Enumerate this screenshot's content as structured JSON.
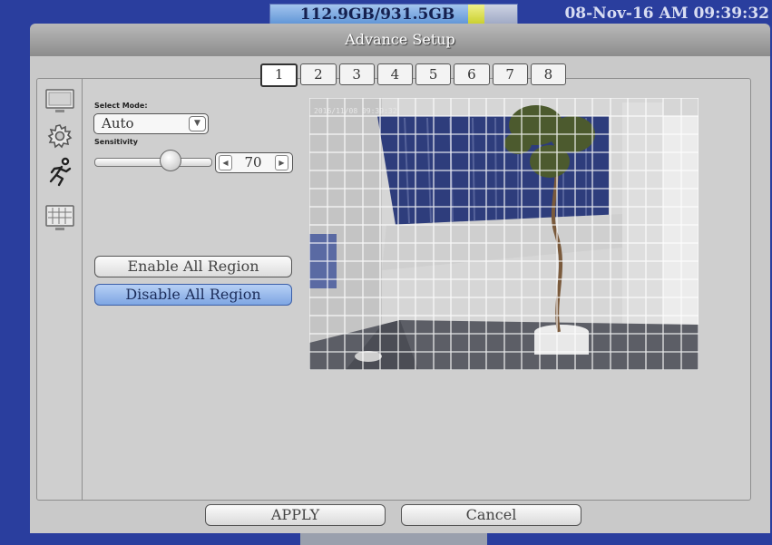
{
  "status": {
    "disk_usage": "112.9GB/931.5GB",
    "disk_used_fraction": 0.121,
    "datetime": "08-Nov-16 AM 09:39:32"
  },
  "window": {
    "title": "Advance Setup"
  },
  "channels": [
    "1",
    "2",
    "3",
    "4",
    "5",
    "6",
    "7",
    "8"
  ],
  "active_channel": "1",
  "sidebar": {
    "items": [
      {
        "icon": "monitor-icon"
      },
      {
        "icon": "gear-icon"
      },
      {
        "icon": "running-man-icon"
      },
      {
        "icon": "grid-screen-icon"
      }
    ]
  },
  "motion": {
    "mode_label": "Select Mode:",
    "mode_value": "Auto",
    "sensitivity_label": "Sensitivity",
    "sensitivity_value": "70",
    "enable_all_label": "Enable All Region",
    "disable_all_label": "Disable All Region"
  },
  "camera": {
    "timestamp": "2016/11/08 09:39:32"
  },
  "buttons": {
    "apply": "APPLY",
    "cancel": "Cancel"
  },
  "colors": {
    "background": "#2a3e9e",
    "panel": "#c9c9c9",
    "accent_button": "#7ea6e3"
  }
}
